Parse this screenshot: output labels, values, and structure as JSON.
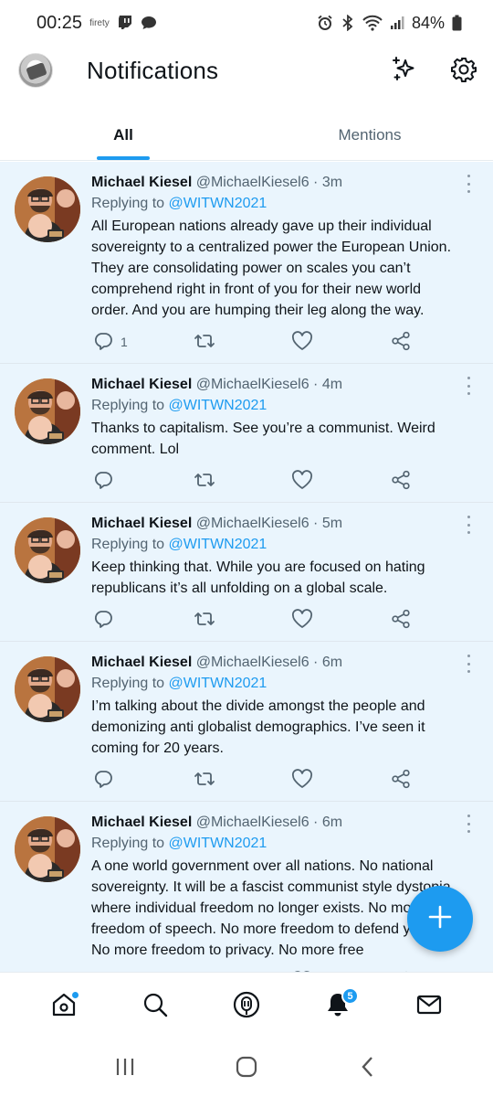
{
  "status_bar": {
    "time": "00:25",
    "app_small_label": "firety",
    "battery": "84%"
  },
  "header": {
    "title": "Notifications"
  },
  "tabs": [
    {
      "label": "All",
      "active": true
    },
    {
      "label": "Mentions",
      "active": false
    }
  ],
  "tweets": [
    {
      "name": "Michael Kiesel",
      "handle": "@MichaelKiesel6",
      "separator": "·",
      "time": "3m",
      "replying_prefix": "Replying to",
      "replying_to": "@WITWN2021",
      "text": "All European nations already gave up their individual sovereignty to a centralized power the European Union. They are consolidating power on scales you can’t comprehend right in front of you for their new world order. And you are humping their leg along the way.",
      "reply_count": "1"
    },
    {
      "name": "Michael Kiesel",
      "handle": "@MichaelKiesel6",
      "separator": "·",
      "time": "4m",
      "replying_prefix": "Replying to",
      "replying_to": "@WITWN2021",
      "text": "Thanks to capitalism. See you’re a communist. Weird comment. Lol",
      "reply_count": ""
    },
    {
      "name": "Michael Kiesel",
      "handle": "@MichaelKiesel6",
      "separator": "·",
      "time": "5m",
      "replying_prefix": "Replying to",
      "replying_to": "@WITWN2021",
      "text": "Keep thinking that. While you are focused on hating republicans it’s all unfolding on a global scale.",
      "reply_count": ""
    },
    {
      "name": "Michael Kiesel",
      "handle": "@MichaelKiesel6",
      "separator": "·",
      "time": "6m",
      "replying_prefix": "Replying to",
      "replying_to": "@WITWN2021",
      "text": "I’m talking about the divide amongst the people and demonizing anti globalist demographics. I’ve seen it coming for 20 years.",
      "reply_count": ""
    },
    {
      "name": "Michael Kiesel",
      "handle": "@MichaelKiesel6",
      "separator": "·",
      "time": "6m",
      "replying_prefix": "Replying to",
      "replying_to": "@WITWN2021",
      "text": "A one world government over all nations. No national sovereignty. It will be a fascist communist style dystopia where individual freedom no longer exists. No more freedom of speech. No more freedom to defend yourself. No more freedom to privacy. No more free",
      "reply_count": ""
    }
  ],
  "bottom_nav": {
    "notifications_badge": "5"
  },
  "colors": {
    "accent": "#1d9bf0",
    "unread_bg": "#eaf5fd",
    "secondary_text": "#536471"
  },
  "icons": [
    "home-icon",
    "search-icon",
    "spaces-icon",
    "bell-icon",
    "mail-icon",
    "sparkle-icon",
    "gear-icon"
  ]
}
